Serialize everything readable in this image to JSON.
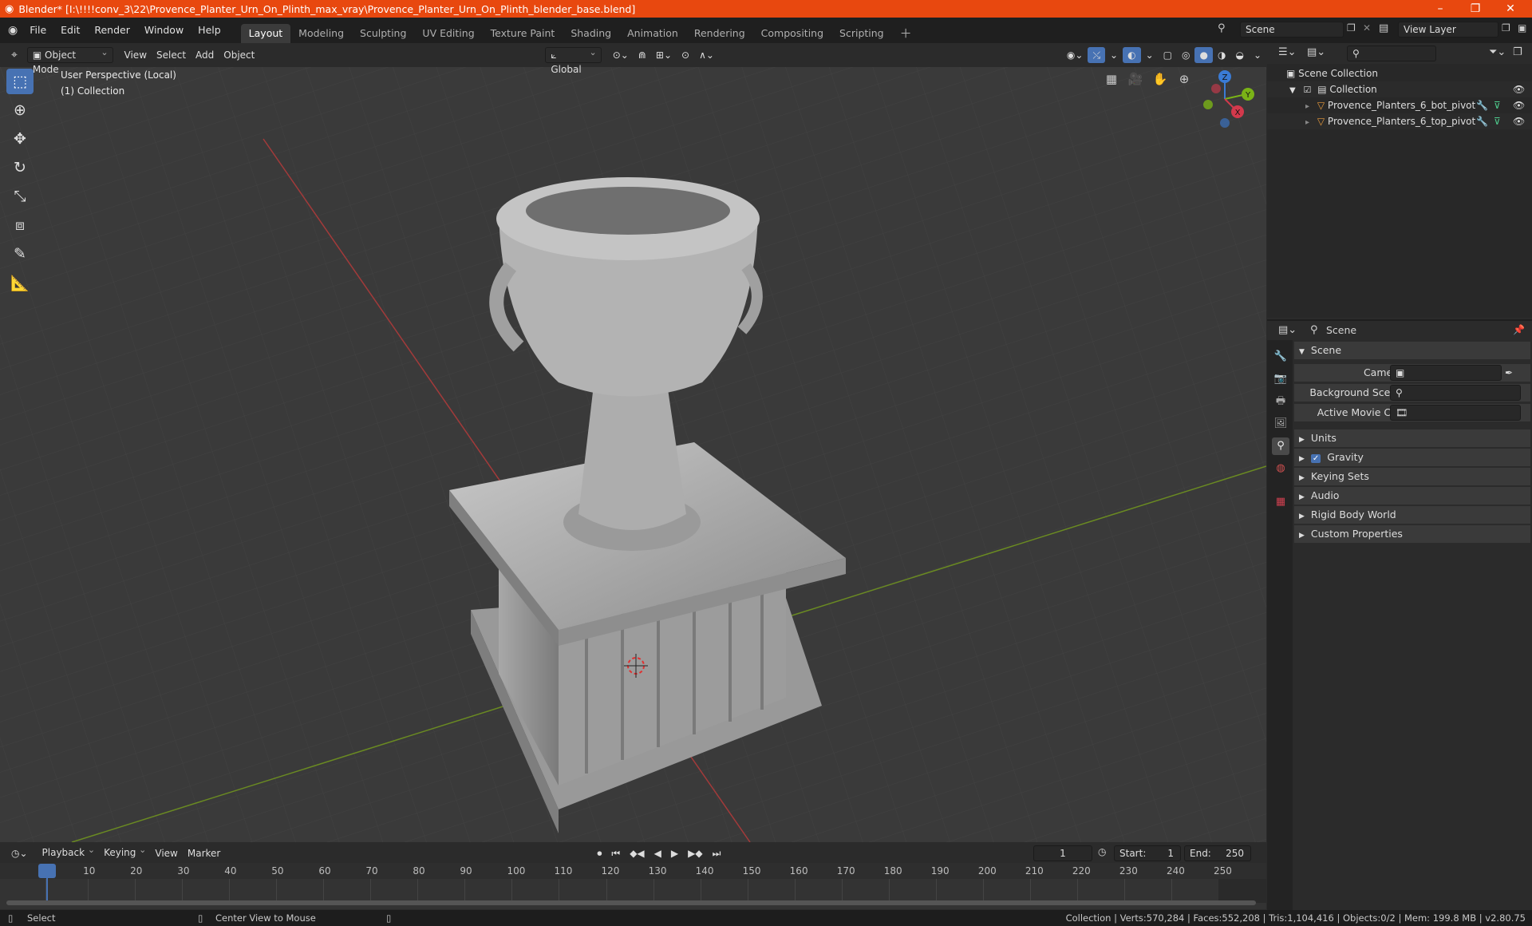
{
  "window": {
    "title": "Blender* [I:\\!!!!conv_3\\22\\Provence_Planter_Urn_On_Plinth_max_vray\\Provence_Planter_Urn_On_Plinth_blender_base.blend]",
    "accent": "#e8480f"
  },
  "menu": {
    "items": [
      "File",
      "Edit",
      "Render",
      "Window",
      "Help"
    ]
  },
  "workspaces": {
    "tabs": [
      "Layout",
      "Modeling",
      "Sculpting",
      "UV Editing",
      "Texture Paint",
      "Shading",
      "Animation",
      "Rendering",
      "Compositing",
      "Scripting"
    ],
    "active": "Layout"
  },
  "scene_field": "Scene",
  "view_layer_field": "View Layer",
  "viewport": {
    "mode": "Object Mode",
    "menus": [
      "View",
      "Select",
      "Add",
      "Object"
    ],
    "orientation": "Global",
    "overlay_line1": "User Perspective (Local)",
    "overlay_line2": "(1) Collection",
    "gizmo": {
      "x": "X",
      "y": "Y",
      "z": "Z"
    }
  },
  "outliner": {
    "root": "Scene Collection",
    "collection": "Collection",
    "objects": [
      "Provence_Planters_6_bot_pivot",
      "Provence_Planters_6_top_pivot"
    ]
  },
  "properties": {
    "header": "Scene",
    "section": "Scene",
    "fields": [
      {
        "label": "Camera",
        "value": ""
      },
      {
        "label": "Background Scene",
        "value": ""
      },
      {
        "label": "Active Movie Clip",
        "value": ""
      }
    ],
    "panels": [
      "Units",
      "Gravity",
      "Keying Sets",
      "Audio",
      "Rigid Body World",
      "Custom Properties"
    ]
  },
  "timeline": {
    "menus": [
      "Playback",
      "Keying",
      "View",
      "Marker"
    ],
    "current_frame": "1",
    "start_label": "Start:",
    "start": "1",
    "end_label": "End:",
    "end": "250",
    "ticks": [
      "1",
      "10",
      "20",
      "30",
      "40",
      "50",
      "60",
      "70",
      "80",
      "90",
      "100",
      "110",
      "120",
      "130",
      "140",
      "150",
      "160",
      "170",
      "180",
      "190",
      "200",
      "210",
      "220",
      "230",
      "240",
      "250"
    ]
  },
  "status": {
    "left": "Select",
    "middle": "Center View to Mouse",
    "right": "Collection | Verts:570,284 | Faces:552,208 | Tris:1,104,416 | Objects:0/2 | Mem: 199.8 MB | v2.80.75"
  }
}
